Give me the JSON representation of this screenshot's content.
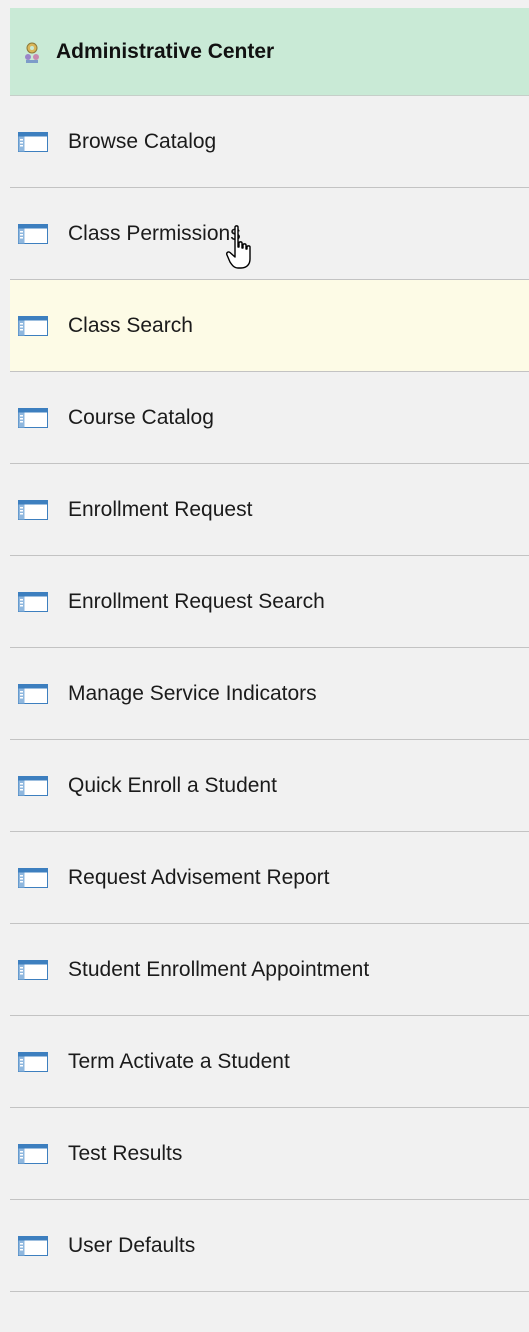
{
  "header": {
    "title": "Administrative Center",
    "icon": "gear-people-icon",
    "background": "#c9ead6"
  },
  "menu": {
    "item_icon": "page-window-icon",
    "highlight_color": "#fdfbe6",
    "items": [
      {
        "label": "Browse Catalog"
      },
      {
        "label": "Class Permissions"
      },
      {
        "label": "Class Search",
        "highlighted": true
      },
      {
        "label": "Course Catalog"
      },
      {
        "label": "Enrollment Request"
      },
      {
        "label": "Enrollment Request Search"
      },
      {
        "label": "Manage Service Indicators"
      },
      {
        "label": "Quick Enroll a Student"
      },
      {
        "label": "Request Advisement Report"
      },
      {
        "label": "Student Enrollment Appointment"
      },
      {
        "label": "Term Activate a Student"
      },
      {
        "label": "Test Results"
      },
      {
        "label": "User Defaults"
      }
    ]
  },
  "cursor": {
    "icon": "hand-pointer-icon",
    "over": "Class Permissions"
  }
}
